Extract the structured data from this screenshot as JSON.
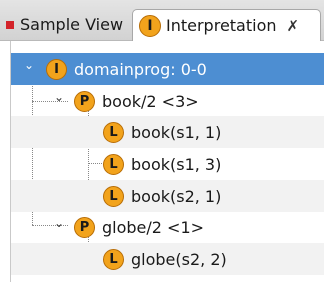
{
  "tabs": [
    {
      "label": "Sample View",
      "icon": "red-square-icon",
      "active": false
    },
    {
      "label": "Interpretation",
      "icon": "interpretation-i-icon",
      "badge": "I",
      "active": true,
      "close_glyph": "✗"
    }
  ],
  "tree": {
    "root": {
      "badge": "I",
      "label": "domainprog: 0-0",
      "expanded": true,
      "selected": true
    },
    "nodes": [
      {
        "badge": "P",
        "label": "book/2 <3>",
        "expanded": true,
        "children": [
          {
            "badge": "L",
            "label": "book(s1, 1)"
          },
          {
            "badge": "L",
            "label": "book(s1, 3)"
          },
          {
            "badge": "L",
            "label": "book(s2, 1)"
          }
        ]
      },
      {
        "badge": "P",
        "label": "globe/2 <1>",
        "expanded": true,
        "children": [
          {
            "badge": "L",
            "label": "globe(s2, 2)"
          }
        ]
      }
    ],
    "expanded_twisty": "⌄"
  },
  "colors": {
    "selection": "#4d8ed2",
    "badge_fill": "#f2a31c",
    "badge_border": "#b86d05",
    "stripe": "#f2f2f2",
    "red_square": "#d3232a"
  }
}
